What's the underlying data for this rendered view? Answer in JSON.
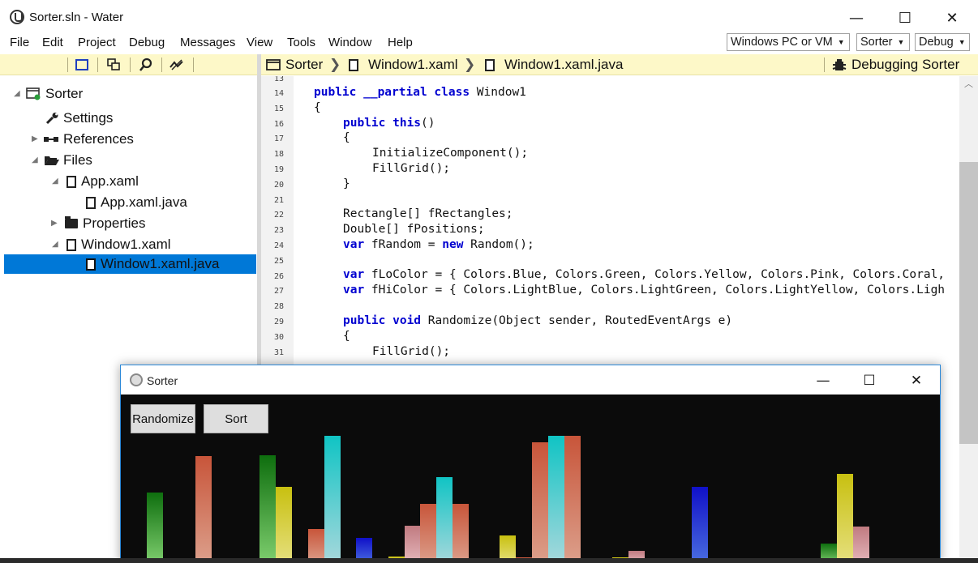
{
  "window": {
    "title": "Sorter.sln - Water",
    "controls": [
      "—",
      "☐",
      "✕"
    ]
  },
  "menu": [
    "File",
    "Edit",
    "Project",
    "Debug",
    "Messages",
    "View",
    "Tools",
    "Window",
    "Help"
  ],
  "combos": {
    "target": "Windows PC or VM",
    "project": "Sorter",
    "config": "Debug"
  },
  "breadcrumb": {
    "items": [
      "Sorter",
      "Window1.xaml",
      "Window1.xaml.java"
    ],
    "status": "Debugging Sorter"
  },
  "tree": [
    {
      "label": "Sorter",
      "icon": "project-icon",
      "expanded": true
    },
    {
      "label": "Settings",
      "icon": "wrench-icon"
    },
    {
      "label": "References",
      "icon": "references-icon",
      "expanded": false
    },
    {
      "label": "Files",
      "icon": "folder-open-icon",
      "expanded": true
    },
    {
      "label": "App.xaml",
      "icon": "file-icon",
      "expanded": true
    },
    {
      "label": "App.xaml.java",
      "icon": "code-file-icon"
    },
    {
      "label": "Properties",
      "icon": "folder-icon",
      "expanded": false
    },
    {
      "label": "Window1.xaml",
      "icon": "file-icon",
      "expanded": true
    },
    {
      "label": "Window1.xaml.java",
      "icon": "code-file-icon",
      "selected": true
    }
  ],
  "editor": {
    "line_numbers": [
      "13",
      "14",
      "15",
      "16",
      "17",
      "18",
      "19",
      "20",
      "21",
      "22",
      "23",
      "24",
      "25",
      "26",
      "27",
      "28",
      "29",
      "30",
      "31"
    ],
    "lines": [
      {
        "n": "14",
        "indent": 0,
        "kw": "public __partial class",
        "rest": " Window1"
      },
      {
        "n": "15",
        "indent": 0,
        "kw": "",
        "rest": "{"
      },
      {
        "n": "16",
        "indent": 1,
        "kw": "public this",
        "rest": "()"
      },
      {
        "n": "17",
        "indent": 1,
        "kw": "",
        "rest": "{"
      },
      {
        "n": "18",
        "indent": 2,
        "kw": "",
        "rest": "InitializeComponent();"
      },
      {
        "n": "19",
        "indent": 2,
        "kw": "",
        "rest": "FillGrid();"
      },
      {
        "n": "20",
        "indent": 1,
        "kw": "",
        "rest": "}"
      },
      {
        "n": "22",
        "indent": 1,
        "kw": "",
        "rest": "Rectangle[] fRectangles;"
      },
      {
        "n": "23",
        "indent": 1,
        "kw": "",
        "rest": "Double[] fPositions;"
      },
      {
        "n": "24",
        "indent": 1,
        "kw": "var",
        "rest": " fRandom = ",
        "kw2": "new",
        "rest2": " Random();"
      },
      {
        "n": "26",
        "indent": 1,
        "kw": "var",
        "rest": " fLoColor = { Colors.Blue, Colors.Green, Colors.Yellow, Colors.Pink, Colors.Coral,"
      },
      {
        "n": "27",
        "indent": 1,
        "kw": "var",
        "rest": " fHiColor = { Colors.LightBlue, Colors.LightGreen, Colors.LightYellow, Colors.Ligh"
      },
      {
        "n": "29",
        "indent": 1,
        "kw": "public void",
        "rest": " Randomize(Object sender, RoutedEventArgs e)"
      },
      {
        "n": "30",
        "indent": 1,
        "kw": "",
        "rest": "{"
      },
      {
        "n": "31",
        "indent": 2,
        "kw": "",
        "rest": "FillGrid();"
      }
    ]
  },
  "sorter": {
    "title": "Sorter",
    "buttons": [
      "Randomize",
      "Sort"
    ],
    "bars": [
      {
        "color": "green",
        "value": 0.56
      },
      {
        "color": "coral",
        "value": 0.84
      },
      {
        "color": "green",
        "value": 0.85
      },
      {
        "color": "yellow",
        "value": 0.6
      },
      {
        "color": "pink",
        "value": 0.04
      },
      {
        "color": "coral",
        "value": 0.27
      },
      {
        "color": "teal",
        "value": 1.0
      },
      {
        "color": "blue",
        "value": 0.2
      },
      {
        "color": "yellow",
        "value": 0.06
      },
      {
        "color": "pink",
        "value": 0.3
      },
      {
        "color": "coral",
        "value": 0.47
      },
      {
        "color": "teal",
        "value": 0.68
      },
      {
        "color": "coral",
        "value": 0.47
      },
      {
        "color": "yellow",
        "value": 0.22
      },
      {
        "color": "coral",
        "value": 0.05
      },
      {
        "color": "coral",
        "value": 0.95
      },
      {
        "color": "teal",
        "value": 1.0
      },
      {
        "color": "coral",
        "value": 1.0
      },
      {
        "color": "yellow",
        "value": 0.05
      },
      {
        "color": "pink",
        "value": 0.1
      },
      {
        "color": "blue",
        "value": 0.6
      },
      {
        "color": "green",
        "value": 0.16
      },
      {
        "color": "yellow",
        "value": 0.7
      },
      {
        "color": "pink",
        "value": 0.29
      }
    ]
  },
  "colors": {
    "toolbar_bg": "#fdf8c8",
    "selection": "#0078d7",
    "keyword": "#0000d0",
    "green": [
      "#0e6e0e",
      "#7fcf6f"
    ],
    "coral": [
      "#c8553a",
      "#dca08c"
    ],
    "yellow": [
      "#c8c010",
      "#e6e080"
    ],
    "pink": [
      "#c07a80",
      "#e6b8bc"
    ],
    "teal": [
      "#10c4c4",
      "#a8d8dc"
    ],
    "blue": [
      "#1010c8",
      "#4a6ee0"
    ]
  }
}
